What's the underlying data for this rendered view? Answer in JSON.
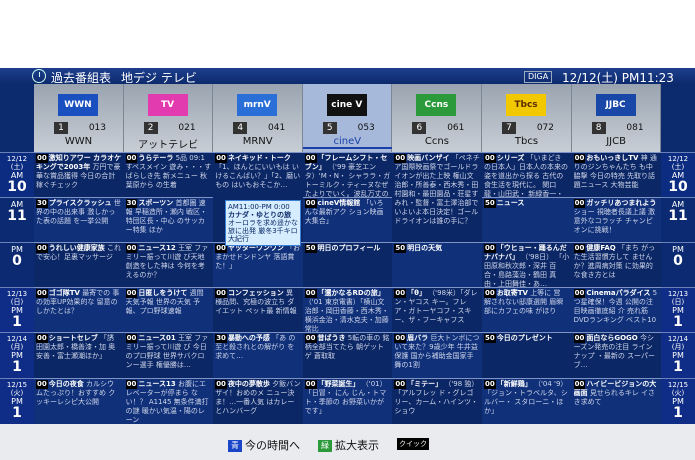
{
  "topbar": {
    "title": "過去番組表",
    "band": "地デジ テレビ",
    "badge": "DIGA",
    "clock": "12/12(土) PM11:23"
  },
  "colors": {
    "nhk": "#1a4fc0",
    "tv_asahi": "#e23bb0",
    "mrnv": "#2a6fd8",
    "cinev": "#111",
    "ccns": "#2a9a3a",
    "tbcs": "#f2c900",
    "jjcb": "#1947a8"
  },
  "channels": [
    {
      "logo": "WWN",
      "num": "1",
      "sub": "013",
      "name": "WWN",
      "logo_icon": "wwn-logo-icon"
    },
    {
      "logo": "TV",
      "num": "2",
      "sub": "021",
      "name": "アットテレビ",
      "logo_icon": "attv-logo-icon"
    },
    {
      "logo": "mrnV",
      "num": "4",
      "sub": "041",
      "name": "MRNV",
      "logo_icon": "mrnv-logo-icon"
    },
    {
      "logo": "cine V",
      "num": "5",
      "sub": "053",
      "name": "cineV",
      "logo_icon": "cinev-logo-icon"
    },
    {
      "logo": "Ccns",
      "num": "6",
      "sub": "061",
      "name": "Ccns",
      "logo_icon": "ccns-logo-icon"
    },
    {
      "logo": "Tbcs",
      "num": "7",
      "sub": "072",
      "name": "Tbcs",
      "logo_icon": "tbcs-logo-icon"
    },
    {
      "logo": "JJBC",
      "num": "8",
      "sub": "081",
      "name": "JJCB",
      "logo_icon": "jjcb-logo-icon"
    }
  ],
  "times_left": [
    {
      "d": "12/12 (土)",
      "ap": "AM",
      "h": "10"
    },
    {
      "d": "",
      "ap": "AM",
      "h": "11"
    },
    {
      "d": "",
      "ap": "PM",
      "h": "0"
    },
    {
      "d": "12/13 (日)",
      "ap": "PM",
      "h": "1"
    },
    {
      "d": "12/14 (月)",
      "ap": "PM",
      "h": "1"
    },
    {
      "d": "12/15 (火)",
      "ap": "PM",
      "h": "1"
    }
  ],
  "programs": [
    [
      {
        "min": "00",
        "title": "激知りアワー カラオケキングで2003年",
        "desc": "万円で豪華な賞品獲得 今日の合計稼ぐチェック"
      },
      {
        "min": "30",
        "title": "プライスクラッシュ",
        "desc": "世界の中の出来事 激しかった表の話題 を一挙公開"
      },
      {
        "min": "00",
        "title": "うれしい健康家族",
        "desc": "これで安心！足裏マッサージ"
      },
      {
        "min": "00",
        "title": "ゴゴ隊TV",
        "desc": "最寄での 事の効率UP効果的な 留意のしかたとは？"
      },
      {
        "min": "00",
        "title": "ショートセレブ",
        "desc": "「誘 田園太郎・橋善漆・加 奥安善・富士瀬潮ほか」"
      },
      {
        "min": "00",
        "title": "今日の夜食",
        "desc": "カルシウ ムたっぷり！おすすめ クッキーレシピ大公開"
      }
    ],
    [
      {
        "min": "00",
        "title": "うらテーラ",
        "desc": "5品 09:1 すペスメイン 遊み・・・すばらしき先 新メニュー 秋葉原から の生着"
      },
      {
        "min": "30",
        "title": "スポーツン",
        "desc": "首都圏 速報 早稲造所・瀬内 戦区・特団区長・中心 のサッカー特集 ほか"
      },
      {
        "min": "00",
        "title": "ニュース12",
        "desc": "王室 ファミリー振って川遊 び天地創造をした神は 今何を考えるのか？"
      },
      {
        "min": "00",
        "title": "日匿しをうけて",
        "desc": "週間 天気予報 世界の天気 予報、プロ野球速報"
      },
      {
        "min": "00",
        "title": "ニュース01",
        "desc": "王室 ファミリー振って川遊 び 今日のプロ野球 世界サバクロンー選手 権優勝は…"
      },
      {
        "min": "00",
        "title": "ニュース13",
        "desc": "お腹にエレベーターが停まら ない！？ A1145 無条件満打の謎 暖かい気温・陽のレーン"
      }
    ],
    [
      {
        "min": "00",
        "title": "ネイキッド・トーク",
        "desc": "「1、ほんとにいいもは いけるこんばい？」「2、磨いもの はいもおそこか…"
      },
      {
        "min": "00",
        "title": "ヤッターワンワン",
        "desc": "「おまかせドンドンヤ 落語賞た！」"
      },
      {
        "min": "00",
        "title": "コンフェッション",
        "desc": "異 様品問、究極の波立ち ダイエット ペット最 新情報"
      },
      {
        "min": "30",
        "title": "暴動への予感",
        "desc": "「あ の至と殺されとの解がり を求めて…"
      },
      {
        "min": "00",
        "title": "夜中の夢散歩",
        "desc": "夕飯バンザイ！おめのメ ニュー決ま！…一番人気 はカレーとハンバーグ"
      }
    ],
    [
      {
        "min": "00",
        "title": "「フレームシフト・セブン」",
        "desc": "（'99 豪芝エンタ）'M・N・ シャララ・ガトーミルク・ティーヌなぜたよりでいく。波乱万丈の大政治アクション。"
      },
      {
        "min": "00",
        "title": "cineV情報館",
        "desc": "「いろんな最新アク ション映画大集合」"
      },
      {
        "min": "50",
        "title": "明日のプロフィール",
        "desc": ""
      },
      {
        "min": "00",
        "title": "「還かなるRDの旅」",
        "desc": "（'01 東京電書）「横山文治郎・岡田香藤・西木秀・横浜金治・清水克夫・加藤常比"
      },
      {
        "min": "00",
        "title": "昔ばうき",
        "desc": "5転の車の 銘柄全部当てたら 朝ゲット ゲ 蒼取取"
      },
      {
        "min": "00",
        "title": "「野菜誕生」",
        "desc": "（'01）「日冒・ にん じん・トマト・季節の お野菜いかがです」"
      }
    ],
    [
      {
        "min": "00",
        "title": "映画バンザイ",
        "desc": "「ペネチア国際映画祭でゴールドライオンが出た上映 権山文治郎・所善泰・西木秀・田村園和・最田園品・荘星すみれ・監督・富土澤治部で いよいよ本日決定！ゴールドライオンは誰の手に？"
      },
      {
        "min": "50",
        "title": "明日の天気",
        "desc": ""
      },
      {
        "min": "00",
        "title": "「θ」",
        "desc": "（'98米）「ダレン・ヤコス キー。フレア・ガトーヤコフ・スキー、ザ・フーキャフス"
      },
      {
        "min": "00",
        "title": "眉バラ",
        "desc": "巨大トンボにつ いて来た？9歳少年 牛井益保護 国から補助金国家手舞の1割"
      },
      {
        "min": "00",
        "title": "「ミテー」",
        "desc": "（'98 独）「アルフレッ ド・グレゴリー、カーム・ハインツ・ショウ"
      }
    ],
    [
      {
        "min": "00",
        "title": "シリーズ",
        "desc": "「いまどき の日本人」日本人の本来の姿を道出から探る 古代の食生活を現代に。 関口龍・山田武・ 新緑香一・中山風 ゲスト ハリー・カルーソ 音楽 シ ミーズー、ワイズ スーパースタンプ"
      },
      {
        "min": "50",
        "title": "ニュース",
        "desc": ""
      },
      {
        "min": "00",
        "title": "「ウヒョー・踊るんだ ナバナバ」",
        "desc": "（'98日） 「小田原和秋次郎・深井 百合・島路藻治・鶴田 真由・上田舞佳・あ…"
      },
      {
        "min": "00",
        "title": "お取寄TV",
        "desc": "上等に 営 解されない邸康選開 眉瞬部にカフェの味 がほり"
      },
      {
        "min": "50",
        "title": "今日のプレゼント",
        "desc": ""
      },
      {
        "min": "00",
        "title": "「新鮮鶏」",
        "desc": "（'04 '9） 「ジョン・トラベルタ、シルバー・ スタローニ・ほか」"
      }
    ],
    [
      {
        "min": "00",
        "title": "おもいっきしTV",
        "desc": "神 通りのジンちゃんたち も中脇撃 今日の特売 先取り話題ニュース 大物芸能"
      },
      {
        "min": "00",
        "title": "ガッチリあつまれよう",
        "desc": "ショー 視聴者長議上議 激 意外なコラッチ チャンピオンに挑戦！"
      },
      {
        "min": "00",
        "title": "健康FAQ",
        "desc": "「まち がった生活習慣方して ませんか？進周病対策 に効果的な食き方とは"
      },
      {
        "min": "00",
        "title": "Cinemaパラダイス",
        "desc": "5つ星確保！今週 公開の注目映画徹底紹 介 売れ筋DVDランキング ベスト10"
      },
      {
        "min": "00",
        "title": "面白ならGOGO",
        "desc": "今シーズン発売の注目 ラインナップ ・最新の スーパーブ…"
      },
      {
        "min": "00",
        "title": "ハイビービジョンの大 画面",
        "desc": "見せられるキレ イさき求めて"
      }
    ]
  ],
  "popup": {
    "line1": "AM11:00-PM 0:00",
    "line2": "カナダ・ゆとりの旅",
    "line3": "オーロラを求め遥かな旅に出発 厳冬3千キロ大紀行"
  },
  "bottom": {
    "blue_key": "青",
    "blue_label": "今の時間へ",
    "green_key": "緑",
    "green_label": "拡大表示",
    "quick": "クイック"
  }
}
